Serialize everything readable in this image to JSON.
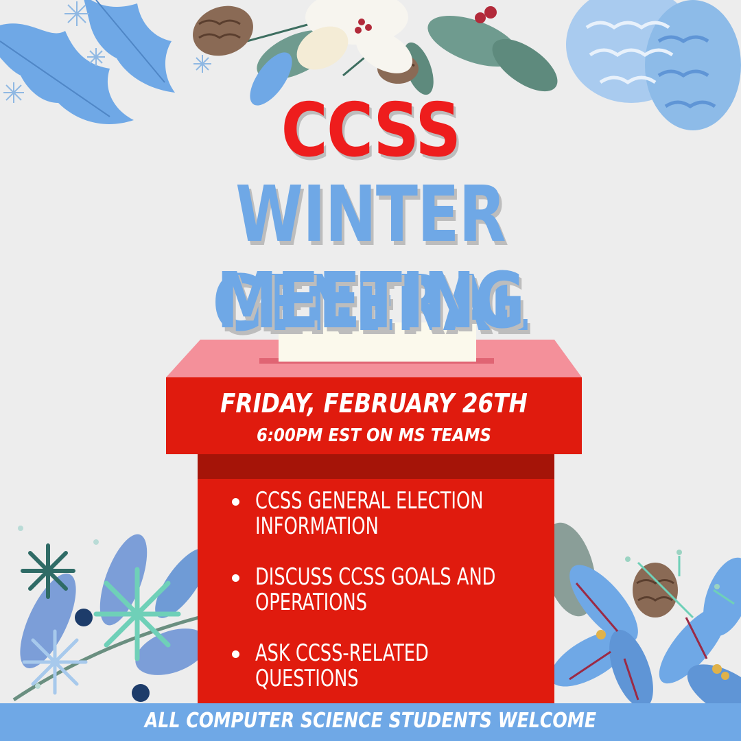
{
  "poster": {
    "org": "CCSS",
    "title_line_1": "WINTER GENERAL",
    "title_line_2": "MEETING",
    "date": "FRIDAY, FEBRUARY 26TH",
    "time": "6:00PM EST ON MS TEAMS",
    "agenda": [
      "CCSS GENERAL ELECTION\nINFORMATION",
      "DISCUSS CCSS GOALS AND\nOPERATIONS",
      "ASK CCSS-RELATED\nQUESTIONS"
    ],
    "footer": "ALL COMPUTER SCIENCE STUDENTS WELCOME"
  },
  "colors": {
    "background": "#ededed",
    "accent_red": "#ee1d1d",
    "accent_blue": "#6fa8e6",
    "box_red": "#e01b0e",
    "box_lid_pink": "#f4909a"
  },
  "decorations": {
    "top": [
      "holly-leaves-icon",
      "pinecone-icon",
      "poinsettia-icon",
      "snowflake-icon",
      "berries-icon"
    ],
    "bottom_left": [
      "leaves-icon",
      "snowflake-icon",
      "berries-icon"
    ],
    "bottom_right": [
      "poinsettia-icon",
      "pinecone-icon",
      "leaves-icon"
    ],
    "center": [
      "ballot-box-icon",
      "ballot-paper-icon"
    ]
  }
}
